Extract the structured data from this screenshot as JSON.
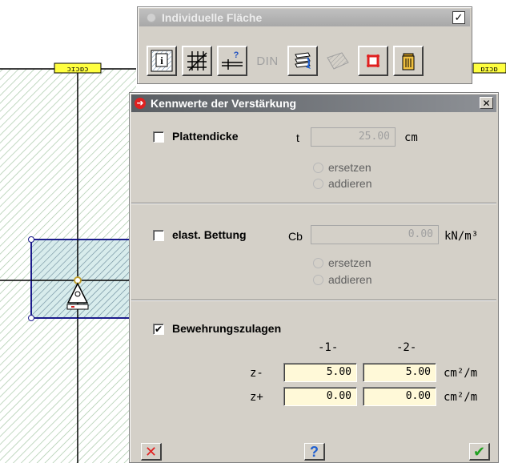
{
  "toolbar": {
    "title": "Individuelle Fläche",
    "checked_mark": "✓",
    "buttons": [
      {
        "name": "info-icon",
        "glyph": "i"
      },
      {
        "name": "grid-icon"
      },
      {
        "name": "help-line-icon",
        "glyph": "?"
      },
      {
        "name": "din-icon",
        "label": "DIN"
      },
      {
        "name": "layers-refresh-icon"
      },
      {
        "name": "hatch-disabled-icon"
      },
      {
        "name": "red-frame-icon"
      },
      {
        "name": "trash-icon"
      }
    ]
  },
  "dialog": {
    "title": "Kennwerte der Verstärkung",
    "close_glyph": "✕",
    "plattendicke": {
      "checkbox_label": "Plattendicke",
      "checked": false,
      "symbol": "t",
      "value": "25.00",
      "unit": "cm",
      "options": [
        "ersetzen",
        "addieren"
      ]
    },
    "bettung": {
      "checkbox_label": "elast. Bettung",
      "checked": false,
      "symbol": "Cb",
      "value": "0.00",
      "unit": "kN/m³",
      "options": [
        "ersetzen",
        "addieren"
      ]
    },
    "bewehrung": {
      "checkbox_label": "Bewehrungszulagen",
      "checked": true,
      "check_glyph": "✔",
      "col_headers": [
        "-1-",
        "-2-"
      ],
      "rows": [
        {
          "label": "z-",
          "v1": "5.00",
          "v2": "5.00",
          "unit": "cm²/m"
        },
        {
          "label": "z+",
          "v1": "0.00",
          "v2": "0.00",
          "unit": "cm²/m"
        }
      ]
    },
    "footer": {
      "cancel_glyph": "✕",
      "help_glyph": "?",
      "ok_glyph": "✔"
    }
  },
  "colors": {
    "cancel": "#e02020",
    "help": "#2060d0",
    "ok": "#20a020",
    "hatch": "#cfe3cf",
    "selection": "#1c1c8c"
  }
}
